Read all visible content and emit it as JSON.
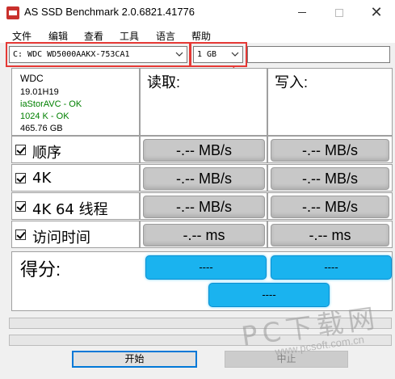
{
  "window": {
    "title": "AS SSD Benchmark 2.0.6821.41776"
  },
  "menu": [
    "文件",
    "编辑",
    "查看",
    "工具",
    "语言",
    "帮助"
  ],
  "drive_select": {
    "value": "C: WDC WD5000AAKX-753CA1"
  },
  "size_select": {
    "value": "1 GB"
  },
  "drive_info": {
    "model": "WDC",
    "firmware": "19.01H19",
    "driver": "iaStorAVC - OK",
    "alignment": "1024 K - OK",
    "capacity": "465.76 GB",
    "ok_color": "#008000"
  },
  "headers": {
    "read": "读取:",
    "write": "写入:"
  },
  "tests": [
    {
      "label": "顺序",
      "read": "-.-- MB/s",
      "write": "-.-- MB/s"
    },
    {
      "label": "4K",
      "read": "-.-- MB/s",
      "write": "-.-- MB/s"
    },
    {
      "label": "4K 64 线程",
      "read": "-.-- MB/s",
      "write": "-.-- MB/s"
    },
    {
      "label": "访问时间",
      "read": "-.-- ms",
      "write": "-.-- ms"
    }
  ],
  "score": {
    "label": "得分:",
    "read": "----",
    "write": "----",
    "total": "----",
    "color": "#1ab3ef"
  },
  "buttons": {
    "start": "开始",
    "abort": "中止"
  },
  "watermark": {
    "brand": "PC下载网",
    "url": "www.pcsoft.com.cn"
  },
  "annotation_color": "#e53935"
}
